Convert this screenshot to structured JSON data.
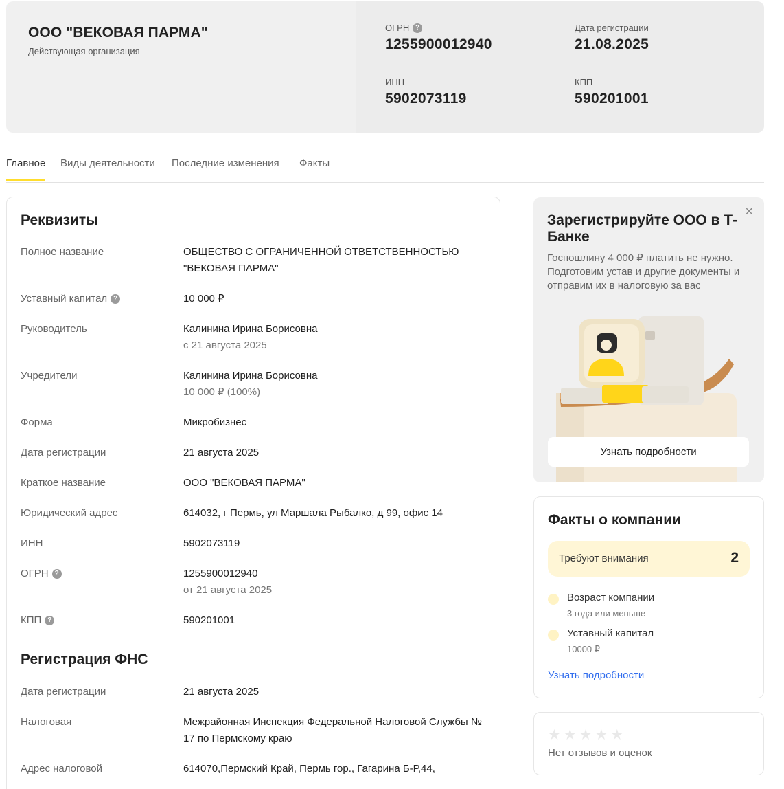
{
  "header": {
    "company_name": "ООО \"ВЕКОВАЯ ПАРМА\"",
    "status": "Действующая организация",
    "ogrn_label": "ОГРН",
    "ogrn_value": "1255900012940",
    "reg_date_label": "Дата регистрации",
    "reg_date_value": "21.08.2025",
    "inn_label": "ИНН",
    "inn_value": "5902073119",
    "kpp_label": "КПП",
    "kpp_value": "590201001"
  },
  "tabs": [
    {
      "label": "Главное",
      "active": true
    },
    {
      "label": "Виды деятельности",
      "active": false
    },
    {
      "label": "Последние изменения",
      "active": false
    },
    {
      "label": "Факты",
      "active": false
    }
  ],
  "requisites": {
    "title": "Реквизиты",
    "full_name_label": "Полное название",
    "full_name_value": "ОБЩЕСТВО С ОГРАНИЧЕННОЙ ОТВЕТСТВЕННОСТЬЮ \"ВЕКОВАЯ ПАРМА\"",
    "capital_label": "Уставный капитал",
    "capital_value": "10 000 ₽",
    "head_label": "Руководитель",
    "head_value": "Калинина Ирина Борисовна",
    "head_sub": "с 21 августа 2025",
    "founders_label": "Учредители",
    "founders_value": "Калинина Ирина Борисовна",
    "founders_sub": "10 000 ₽ (100%)",
    "form_label": "Форма",
    "form_value": "Микробизнес",
    "reg_date_label": "Дата регистрации",
    "reg_date_value": "21 августа 2025",
    "short_name_label": "Краткое название",
    "short_name_value": "ООО \"ВЕКОВАЯ ПАРМА\"",
    "address_label": "Юридический адрес",
    "address_value": "614032, г Пермь, ул Маршала Рыбалко, д 99, офис 14",
    "inn_label": "ИНН",
    "inn_value": "5902073119",
    "ogrn_label": "ОГРН",
    "ogrn_value": "1255900012940",
    "ogrn_sub": "от 21 августа 2025",
    "kpp_label": "КПП",
    "kpp_value": "590201001"
  },
  "fns": {
    "title": "Регистрация ФНС",
    "reg_date_label": "Дата регистрации",
    "reg_date_value": "21 августа 2025",
    "tax_label": "Налоговая",
    "tax_value": "Межрайонная Инспекция Федеральной Налоговой Службы № 17 по Пермскому краю",
    "tax_address_label": "Адрес налоговой",
    "tax_address_value": "614070,Пермский Край, Пермь гор., Гагарина Б-Р,44,"
  },
  "promo": {
    "title": "Зарегистрируйте ООО в Т-Банке",
    "text": "Госпошлину 4 000 ₽ платить не нужно. Подготовим устав и другие документы и отправим их в налоговую за вас",
    "button": "Узнать подробности",
    "close": "×"
  },
  "facts": {
    "title": "Факты о компании",
    "attention_label": "Требуют внимания",
    "attention_count": "2",
    "items": [
      {
        "label": "Возраст компании",
        "sub": "3 года или меньше"
      },
      {
        "label": "Уставный капитал",
        "sub": "10000 ₽"
      }
    ],
    "link": "Узнать подробности"
  },
  "reviews": {
    "stars": "★",
    "rating": 0,
    "text": "Нет отзывов и оценок"
  },
  "icons": {
    "question": "question-circle-icon",
    "close": "close-icon",
    "star": "star-icon",
    "dot": "fact-dot-icon"
  },
  "colors": {
    "accent_yellow": "#ffdd2d",
    "link_blue": "#336fee",
    "attention_bg": "#fff6d6",
    "card_bg": "#f0f0f0"
  }
}
